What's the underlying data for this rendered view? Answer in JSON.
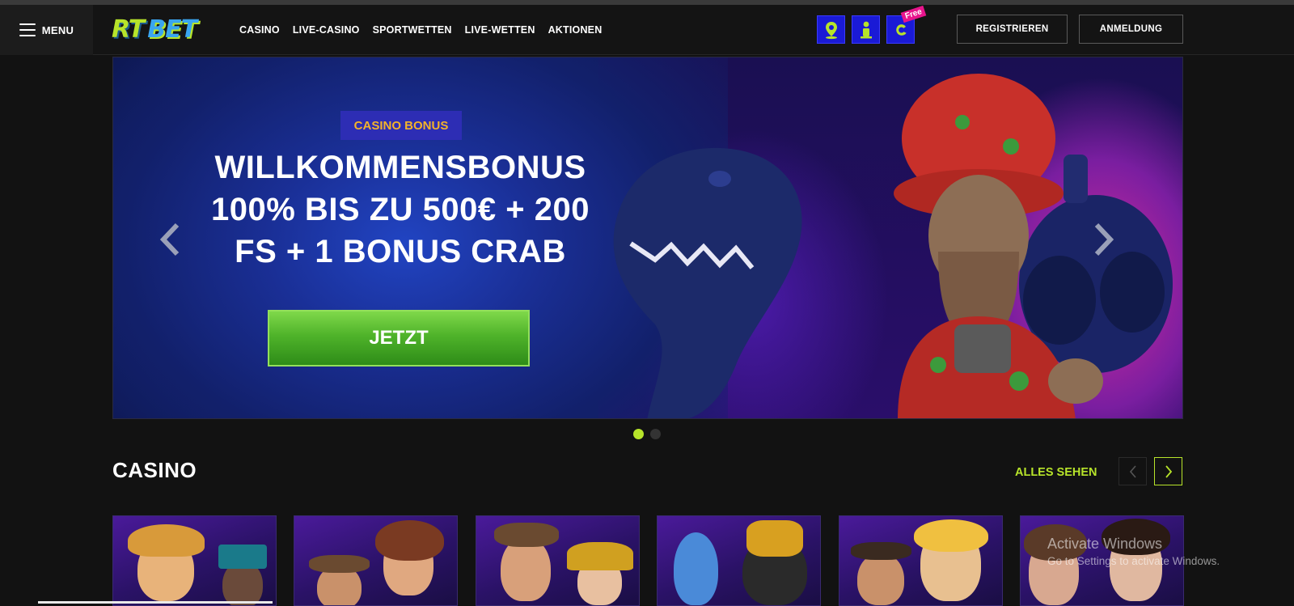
{
  "header": {
    "menu_label": "MENU",
    "logo": {
      "part1": "RT",
      "part2": "BET"
    },
    "nav": [
      "CASINO",
      "LIVE-CASINO",
      "SPORTWETTEN",
      "LIVE-WETTEN",
      "AKTIONEN"
    ],
    "icons": [
      "map-pin-icon",
      "person-icon",
      "coin-icon"
    ],
    "free_tag": "Free",
    "register_label": "REGISTRIEREN",
    "login_label": "ANMELDUNG"
  },
  "hero": {
    "badge": "CASINO BONUS",
    "title_line1": "WILLKOMMENSBONUS",
    "title_line2": "100% BIS ZU 500€ + 200",
    "title_line3": "FS + 1 BONUS CRAB",
    "cta_label": "JETZT",
    "slides_count": 2,
    "active_slide": 1
  },
  "casino_section": {
    "title": "CASINO",
    "see_all": "ALLES SEHEN",
    "game_count_visible": 6
  },
  "watermark": {
    "line1": "Activate Windows",
    "line2": "Go to Settings to activate Windows."
  },
  "colors": {
    "accent_green": "#b7e42a",
    "brand_blue": "#1a1ad6",
    "badge_yellow": "#f4b32a",
    "cta_green": "#4fb32a",
    "free_pink": "#e8148c"
  }
}
